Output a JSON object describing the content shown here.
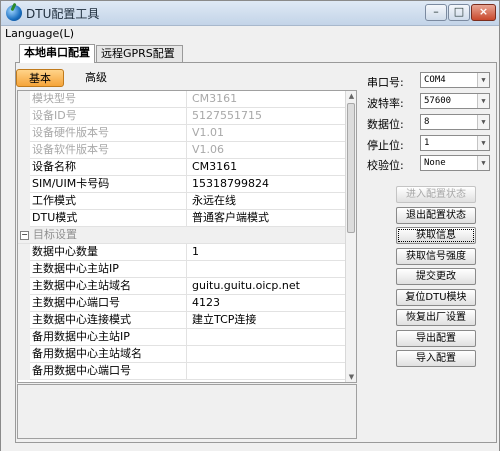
{
  "window": {
    "title": "DTU配置工具"
  },
  "menubar": {
    "language": "Language(L)"
  },
  "tabs": [
    "本地串口配置",
    "远程GPRS配置"
  ],
  "subtabs": [
    "基本",
    "高级"
  ],
  "grid": {
    "rows": [
      {
        "k": "模块型号",
        "v": "CM3161",
        "disabled": true
      },
      {
        "k": "设备ID号",
        "v": "5127551715",
        "disabled": true
      },
      {
        "k": "设备硬件版本号",
        "v": "V1.01",
        "disabled": true
      },
      {
        "k": "设备软件版本号",
        "v": "V1.06",
        "disabled": true
      },
      {
        "k": "设备名称",
        "v": "CM3161"
      },
      {
        "k": "SIM/UIM卡号码",
        "v": "15318799824"
      },
      {
        "k": "工作模式",
        "v": "永远在线"
      },
      {
        "k": "DTU模式",
        "v": "普通客户端模式"
      },
      {
        "k": "目标设置",
        "v": "",
        "category": true,
        "toggle": "−"
      },
      {
        "k": "数据中心数量",
        "v": "1"
      },
      {
        "k": "主数据中心主站IP",
        "v": ""
      },
      {
        "k": "主数据中心主站域名",
        "v": "guitu.guitu.oicp.net"
      },
      {
        "k": "主数据中心端口号",
        "v": "4123"
      },
      {
        "k": "主数据中心连接模式",
        "v": "建立TCP连接"
      },
      {
        "k": "备用数据中心主站IP",
        "v": ""
      },
      {
        "k": "备用数据中心主站域名",
        "v": ""
      },
      {
        "k": "备用数据中心端口号",
        "v": ""
      }
    ]
  },
  "serial": {
    "port_label": "串口号:",
    "port_value": "COM4",
    "baud_label": "波特率:",
    "baud_value": "57600",
    "data_label": "数据位:",
    "data_value": "8",
    "stop_label": "停止位:",
    "stop_value": "1",
    "parity_label": "校验位:",
    "parity_value": "None"
  },
  "actions": [
    {
      "label": "进入配置状态",
      "disabled": true
    },
    {
      "label": "退出配置状态"
    },
    {
      "label": "获取信息",
      "focus": true
    },
    {
      "label": "获取信号强度"
    },
    {
      "label": "提交更改"
    },
    {
      "label": "复位DTU模块"
    },
    {
      "label": "恢复出厂设置"
    },
    {
      "label": "导出配置"
    },
    {
      "label": "导入配置"
    }
  ],
  "icons": {
    "app": "globe-icon",
    "dropdown": "chevron-down-icon",
    "collapse": "minus-box-icon",
    "scroll_up": "arrow-up-icon",
    "scroll_down": "arrow-down-icon"
  }
}
